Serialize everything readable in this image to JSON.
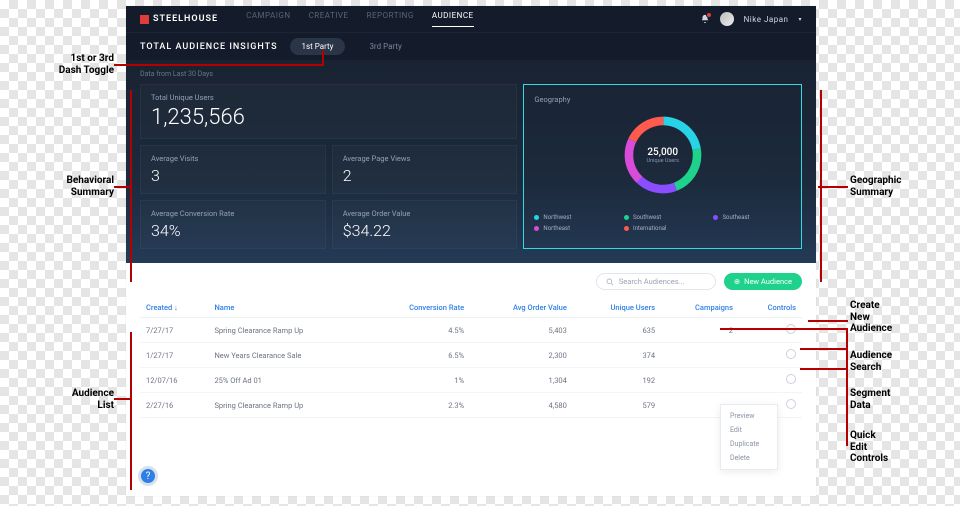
{
  "header": {
    "brand": "STEELHOUSE",
    "nav": [
      "CAMPAIGN",
      "CREATIVE",
      "REPORTING",
      "AUDIENCE"
    ],
    "user": "Nike Japan",
    "notif_count": "1"
  },
  "subheader": {
    "title": "TOTAL AUDIENCE INSIGHTS",
    "tabs": [
      "1st Party",
      "3rd Party"
    ]
  },
  "dash": {
    "subtitle": "Data from Last 30 Days",
    "total_unique_users": {
      "label": "Total Unique Users",
      "value": "1,235,566"
    },
    "avg_visits": {
      "label": "Average Visits",
      "value": "3"
    },
    "avg_page_views": {
      "label": "Average Page Views",
      "value": "2"
    },
    "avg_conv_rate": {
      "label": "Average Conversion Rate",
      "value": "34%"
    },
    "avg_order_value": {
      "label": "Average Order Value",
      "value": "$34.22"
    },
    "geo": {
      "label": "Geography",
      "center_value": "25,000",
      "center_label": "Unique Users",
      "legend": [
        {
          "name": "Northwest",
          "color": "#29d3e6"
        },
        {
          "name": "Southwest",
          "color": "#1fd28c"
        },
        {
          "name": "Southeast",
          "color": "#8a4dff"
        },
        {
          "name": "Northeast",
          "color": "#d94bd9"
        },
        {
          "name": "International",
          "color": "#ff5a4d"
        }
      ]
    }
  },
  "chart_data": {
    "type": "pie",
    "title": "Geography",
    "series": [
      {
        "name": "Northwest",
        "value": 22,
        "color": "#29d3e6"
      },
      {
        "name": "Southwest",
        "value": 22,
        "color": "#1fd28c"
      },
      {
        "name": "Southeast",
        "value": 18,
        "color": "#8a4dff"
      },
      {
        "name": "Northeast",
        "value": 20,
        "color": "#d94bd9"
      },
      {
        "name": "International",
        "value": 18,
        "color": "#ff5a4d"
      }
    ],
    "center": {
      "value": "25,000",
      "label": "Unique Users"
    }
  },
  "list": {
    "search_placeholder": "Search Audiences...",
    "new_label": "New Audience",
    "columns": [
      "Created ↓",
      "Name",
      "Conversion Rate",
      "Avg Order Value",
      "Unique Users",
      "Campaigns",
      "Controls"
    ],
    "rows": [
      {
        "created": "7/27/17",
        "name": "Spring Clearance Ramp Up",
        "cr": "4.5%",
        "aov": "5,403",
        "uu": "635",
        "camp": "2"
      },
      {
        "created": "1/27/17",
        "name": "New Years Clearance Sale",
        "cr": "6.5%",
        "aov": "2,300",
        "uu": "374",
        "camp": ""
      },
      {
        "created": "12/07/16",
        "name": "25% Off Ad 01",
        "cr": "1%",
        "aov": "1,304",
        "uu": "192",
        "camp": ""
      },
      {
        "created": "2/27/16",
        "name": "Spring Clearance Ramp Up",
        "cr": "2.3%",
        "aov": "4,580",
        "uu": "579",
        "camp": ""
      }
    ],
    "context_menu": [
      "Preview",
      "Edit",
      "Duplicate",
      "Delete"
    ]
  },
  "annotations": {
    "toggle": "1st or 3rd\nDash Toggle",
    "behavioral": "Behavioral\nSummary",
    "audience_list": "Audience\nList",
    "geographic": "Geographic\nSummary",
    "create": "Create\nNew\nAudience",
    "search": "Audience\nSearch",
    "segment": "Segment\nData",
    "quick": "Quick\nEdit\nControls"
  }
}
